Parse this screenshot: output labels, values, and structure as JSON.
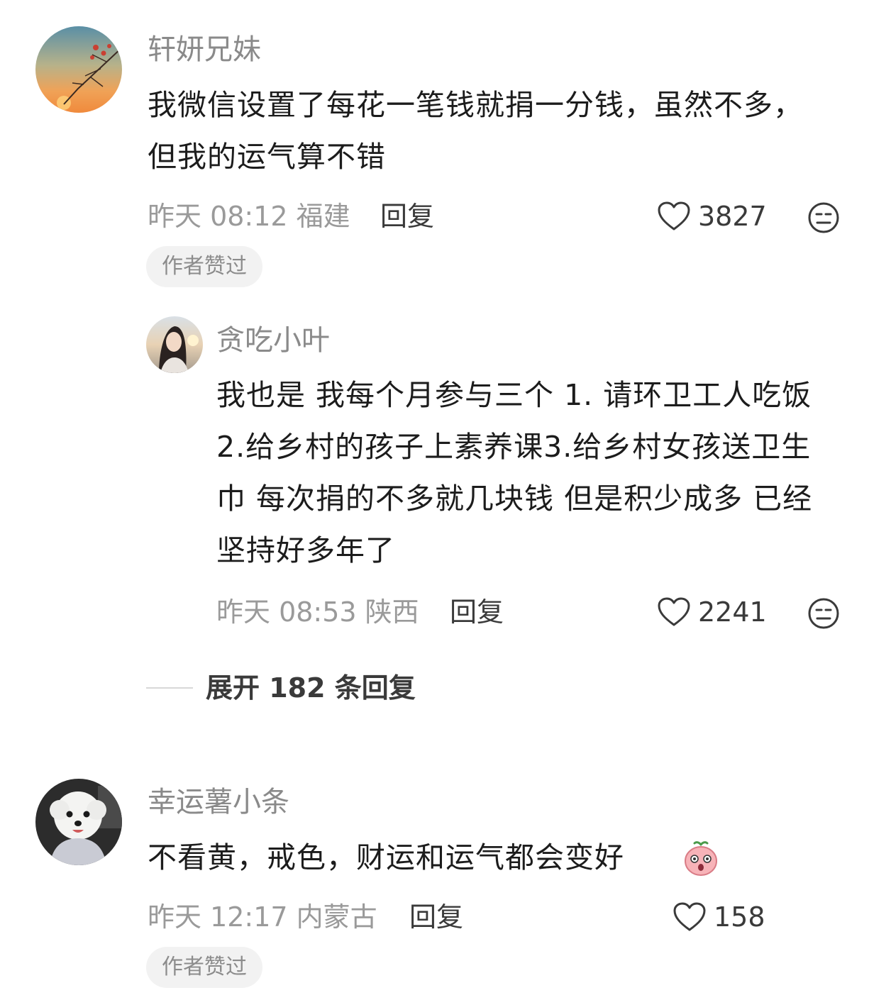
{
  "comments": [
    {
      "name": "轩妍兄妹",
      "text": "我微信设置了每花一笔钱就捐一分钱，虽然不多，但我的运气算不错",
      "time_location": "昨天 08:12 福建",
      "reply_label": "回复",
      "likes": "3827",
      "badge": "作者赞过"
    },
    {
      "name": "贪吃小叶",
      "text": "我也是 我每个月参与三个 1. 请环卫工人吃饭2.给乡村的孩子上素养课3.给乡村女孩送卫生巾 每次捐的不多就几块钱 但是积少成多 已经坚持好多年了",
      "time_location": "昨天 08:53 陕西",
      "reply_label": "回复",
      "likes": "2241"
    },
    {
      "name": "幸运薯小条",
      "text": "不看黄，戒色，财运和运气都会变好",
      "time_location": "昨天 12:17 内蒙古",
      "reply_label": "回复",
      "likes": "158",
      "badge": "作者赞过"
    }
  ],
  "expand_replies": "展开 182 条回复",
  "icons": {
    "like": "heart-outline-icon",
    "dislike": "unhappy-face-icon",
    "emoji": "pink-peach-surprised-emoji"
  },
  "colors": {
    "name": "#8a8a8a",
    "meta": "#9a9a9a",
    "badge_bg": "#f2f2f2"
  }
}
